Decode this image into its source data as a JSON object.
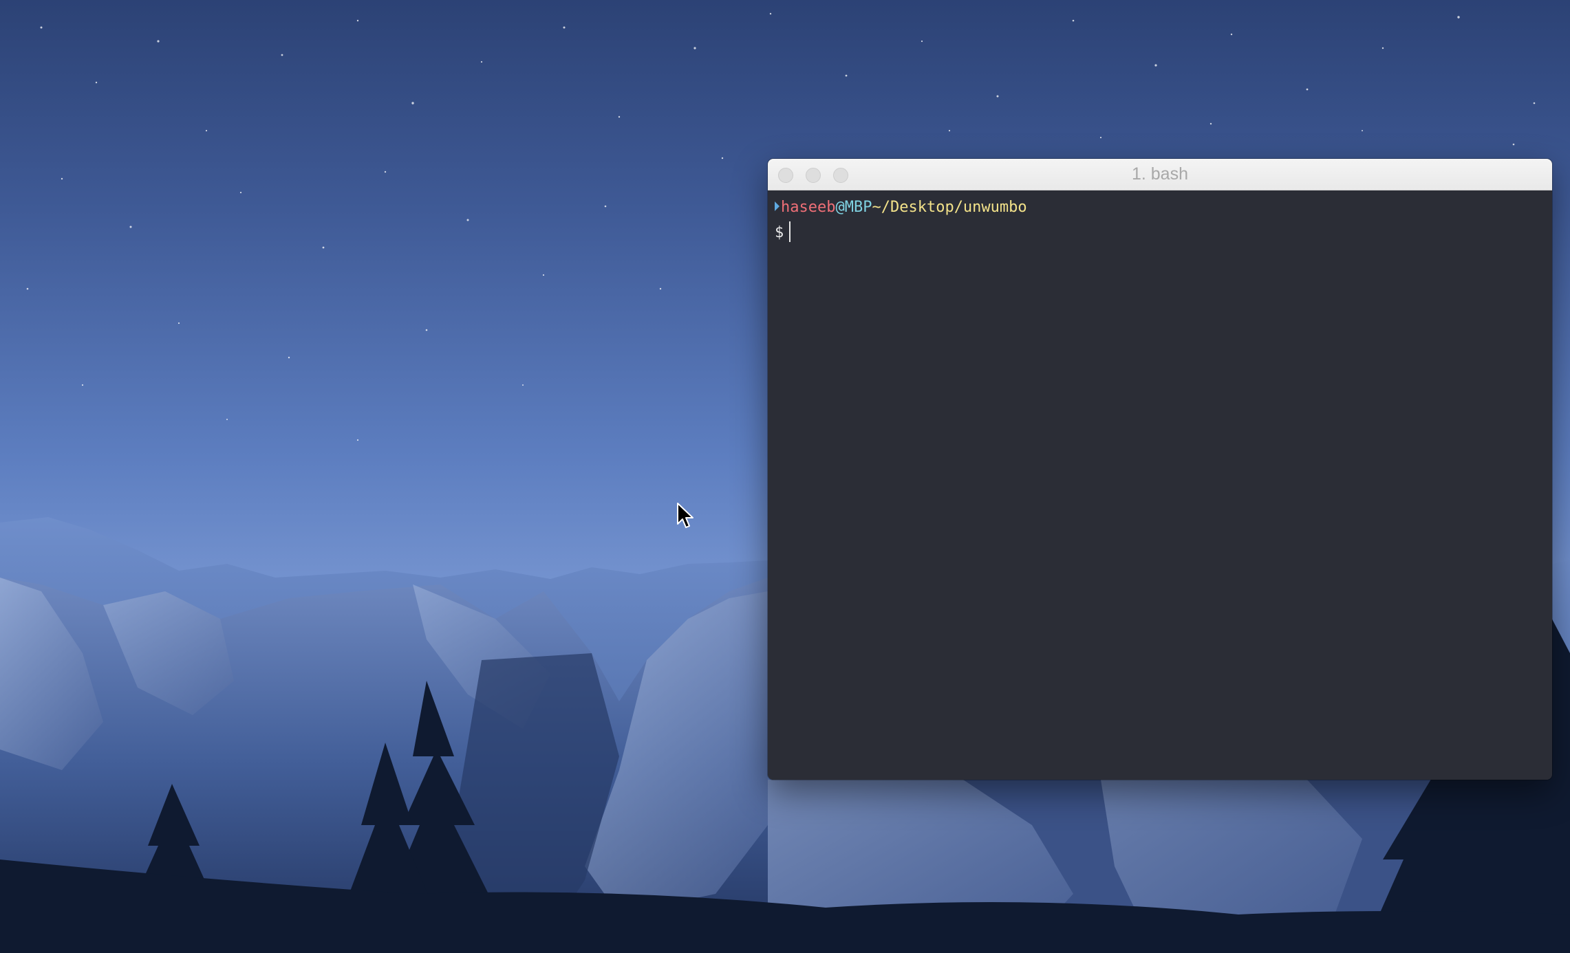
{
  "terminal": {
    "title": "1. bash",
    "prompt": {
      "user": "haseeb",
      "separator": "@",
      "host": "MBP",
      "path": "~/Desktop/unwumbo"
    },
    "input_symbol": "$",
    "input_value": ""
  },
  "colors": {
    "user": "#ef6f77",
    "host": "#7fd2e2",
    "path": "#f3e28a",
    "terminal_background": "#2b2d36"
  },
  "icons": [
    "close-button",
    "minimize-button",
    "zoom-button",
    "mouse-pointer-icon"
  ]
}
